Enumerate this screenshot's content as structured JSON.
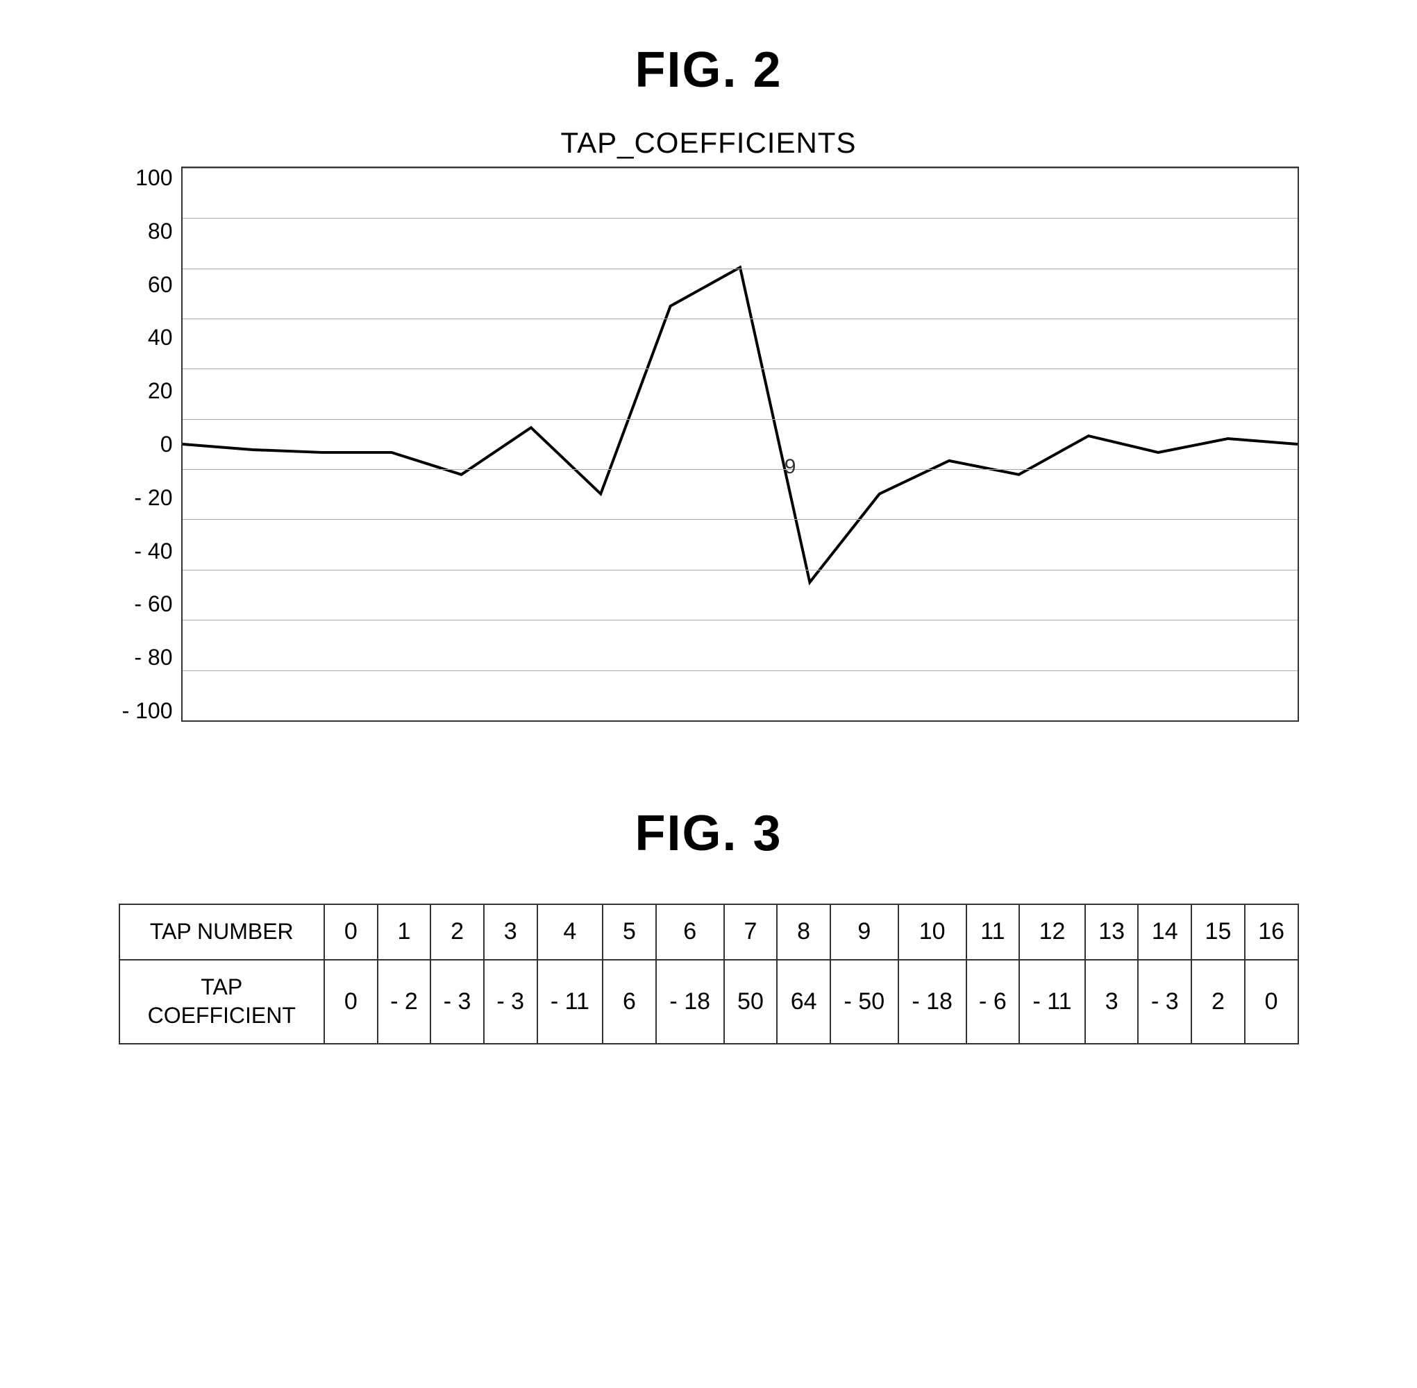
{
  "fig2": {
    "title": "FIG. 2",
    "chart_title": "TAP_COEFFICIENTS",
    "y_axis": {
      "labels": [
        "100",
        "80",
        "60",
        "40",
        "20",
        "0",
        "- 20",
        "- 40",
        "- 60",
        "- 80",
        "- 100"
      ]
    },
    "annotation": "9"
  },
  "fig3": {
    "title": "FIG. 3",
    "table": {
      "row1_header": "TAP NUMBER",
      "row2_header": "TAP\nCOEFFICIENT",
      "tap_numbers": [
        "0",
        "1",
        "2",
        "3",
        "4",
        "5",
        "6",
        "7",
        "8",
        "9",
        "10",
        "11",
        "12",
        "13",
        "14",
        "15",
        "16"
      ],
      "tap_coefficients": [
        "0",
        "-2",
        "-3",
        "-3",
        "-11",
        "6",
        "-18",
        "50",
        "64",
        "-50",
        "-18",
        "-6",
        "-11",
        "3",
        "-3",
        "2",
        "0"
      ]
    }
  }
}
